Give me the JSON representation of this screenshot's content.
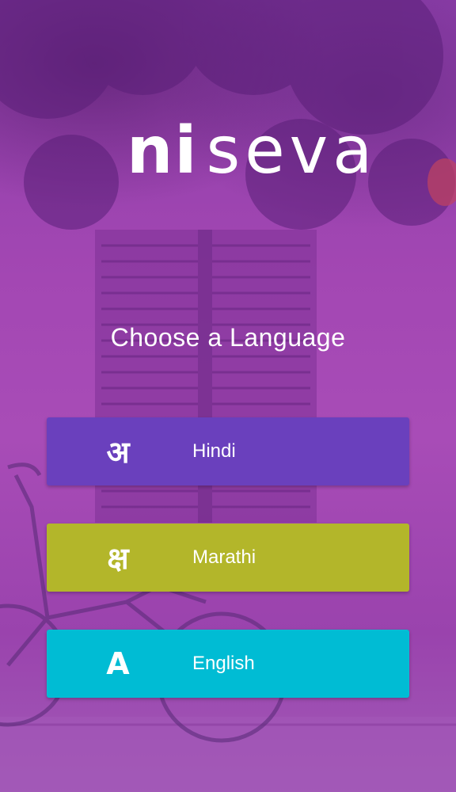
{
  "logo": {
    "part1": "ni",
    "part2": "seva"
  },
  "title": "Choose a Language",
  "languages": [
    {
      "glyph": "अ",
      "label": "Hindi",
      "color": "#6a40bd"
    },
    {
      "glyph": "क्ष",
      "label": "Marathi",
      "color": "#b3b62a"
    },
    {
      "glyph": "A",
      "label": "English",
      "color": "#00bcd4"
    }
  ]
}
